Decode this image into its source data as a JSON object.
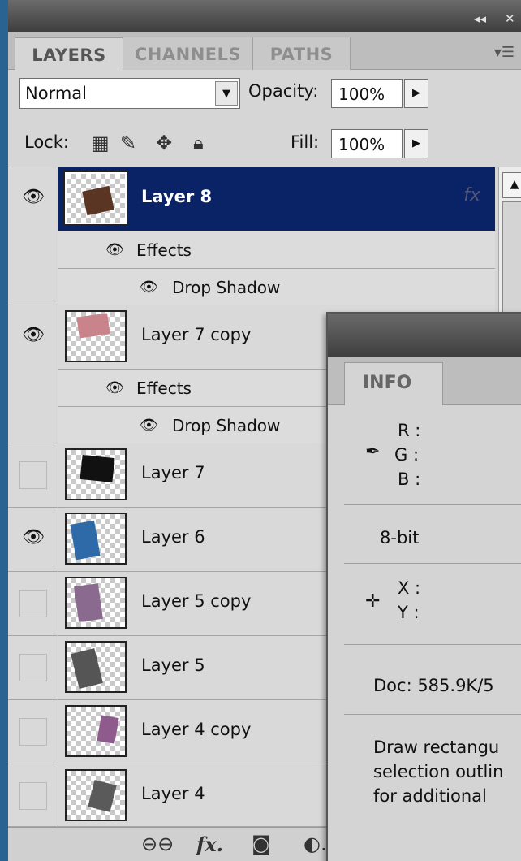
{
  "window": {
    "collapse_label": "◂◂",
    "close_label": "✕"
  },
  "tabs": [
    {
      "label": "LAYERS",
      "active": true
    },
    {
      "label": "CHANNELS",
      "active": false
    },
    {
      "label": "PATHS",
      "active": false
    }
  ],
  "panel_menu_icon": "panel-menu-icon",
  "options": {
    "blend_mode": "Normal",
    "opacity_label": "Opacity:",
    "opacity_value": "100%",
    "lock_label": "Lock:",
    "fill_label": "Fill:",
    "fill_value": "100%"
  },
  "layers": [
    {
      "name": "Layer 8",
      "visible": true,
      "selected": true,
      "effects": [
        "Effects",
        "Drop Shadow"
      ]
    },
    {
      "name": "Layer 7 copy",
      "visible": true,
      "selected": false,
      "effects": [
        "Effects",
        "Drop Shadow"
      ]
    },
    {
      "name": "Layer 7",
      "visible": false,
      "selected": false,
      "effects": []
    },
    {
      "name": "Layer 6",
      "visible": true,
      "selected": false,
      "effects": []
    },
    {
      "name": "Layer 5 copy",
      "visible": false,
      "selected": false,
      "effects": []
    },
    {
      "name": "Layer 5",
      "visible": false,
      "selected": false,
      "effects": []
    },
    {
      "name": "Layer 4 copy",
      "visible": false,
      "selected": false,
      "effects": []
    },
    {
      "name": "Layer 4",
      "visible": false,
      "selected": false,
      "effects": []
    }
  ],
  "effect_labels": {
    "effects": "Effects",
    "drop_shadow": "Drop Shadow"
  },
  "bottom_icons": [
    "link-icon",
    "fx-icon",
    "mask-icon",
    "adjustment-icon"
  ],
  "info_panel": {
    "tab": "INFO",
    "rgb": {
      "r": "R :",
      "g": "G :",
      "b": "B :"
    },
    "bit_depth": "8-bit",
    "xy": {
      "x": "X :",
      "y": "Y :"
    },
    "doc": "Doc: 585.9K/5",
    "hint_lines": [
      "Draw rectangu",
      "selection outlin",
      "for additional"
    ]
  },
  "colors": {
    "selection": "#0a2366",
    "panel_bg": "#d6d6d6",
    "desktop": "#23577e"
  }
}
